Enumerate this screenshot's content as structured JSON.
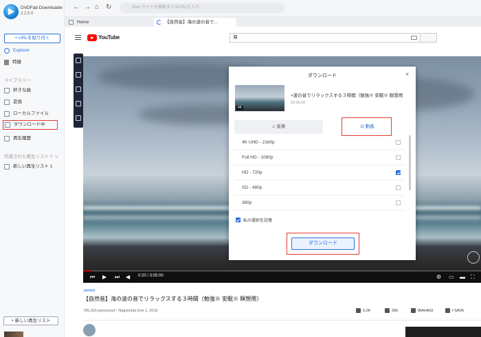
{
  "app": {
    "name": "DVDFab Downloader",
    "version": "2.2.0.0"
  },
  "sidebar": {
    "url_button": "+ URLを貼り付く",
    "items": [
      {
        "label": "Explorer"
      },
      {
        "label": "特器"
      }
    ],
    "library_label": "ライブラリー",
    "library_items": [
      {
        "label": "好きな曲"
      },
      {
        "label": "変換"
      },
      {
        "label": "ローカルファイル"
      },
      {
        "label": "ダウンロード中"
      },
      {
        "label": "再生履歴"
      }
    ],
    "playlist_section": "作成された再生リスト＋ ∨",
    "playlist_items": [
      {
        "label": "新しい再生リスト 1"
      }
    ],
    "new_list_button": "+ 新しい再生リスト"
  },
  "browser": {
    "address_placeholder": "Web サイトを検索またはURLを入力",
    "tabs": [
      {
        "label": "Home"
      },
      {
        "label": "【自然音】海の波の音で..."
      }
    ]
  },
  "youtube": {
    "logo_text": "YouTube",
    "search_value": "海"
  },
  "player": {
    "time": "0:20 / 3:05:00",
    "progress": 0.02
  },
  "dialog": {
    "title": "ダウンロード",
    "close": "×",
    "video_title": "×波の音でリラックスする３時間（勉強※ 安眠※ 瞑想用",
    "video_duration": "03:05:00",
    "thumb_badge": "4K",
    "tabs": {
      "audio": "♫ 音楽",
      "video": "⊡ 動画"
    },
    "qualities": [
      {
        "label": "4K UHD - 2160p",
        "checked": false
      },
      {
        "label": "Full HD - 1080p",
        "checked": false
      },
      {
        "label": "HD - 720p",
        "checked": true
      },
      {
        "label": "SD - 480p",
        "checked": false
      },
      {
        "label": "360p",
        "checked": false
      }
    ],
    "remember": "私の選択を記憶",
    "download_button": "ダウンロード"
  },
  "below": {
    "location": "JAPAN",
    "title": "【自然音】海の波の音でリラックスする３時間（勉強※ 安眠※ 瞑想用）",
    "meta": "795,316 panonood・Nagsimula Ene 1, 2019",
    "actions": [
      {
        "label": "6.2K"
      },
      {
        "label": "265"
      },
      {
        "label": "IBAHAGI"
      },
      {
        "label": "I-SAVE"
      }
    ]
  },
  "colors": {
    "accent": "#2a6fdb",
    "highlight": "#e53935",
    "youtube_red": "#ff0000"
  }
}
